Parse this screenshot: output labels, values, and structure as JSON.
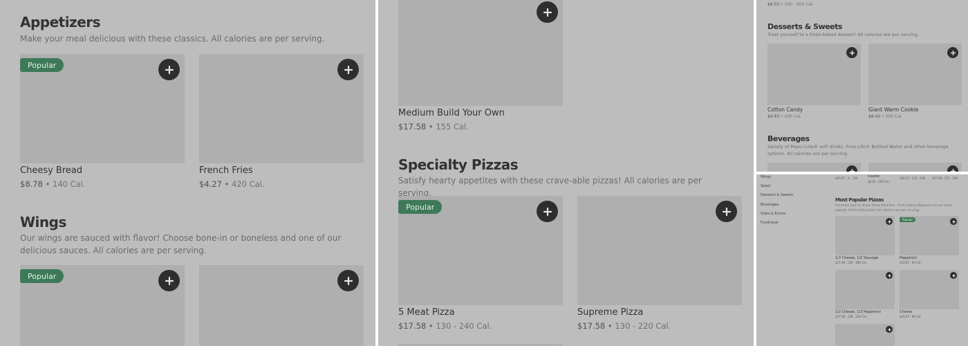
{
  "panel_a": {
    "appetizers": {
      "title": "Appetizers",
      "description": "Make your meal delicious with these classics. All calories are per serving.",
      "items": [
        {
          "badge": "Popular",
          "name": "Cheesy Bread",
          "price": "$8.78",
          "calories": "140 Cal."
        },
        {
          "name": "French Fries",
          "price": "$4.27",
          "calories": "420 Cal."
        }
      ]
    },
    "wings": {
      "title": "Wings",
      "description": "Our wings are sauced with flavor! Choose bone-in or boneless and one of our delicious sauces. All calories are per serving.",
      "items": [
        {
          "badge": "Popular"
        },
        {}
      ]
    }
  },
  "panel_b": {
    "build_your_own": {
      "name": "Medium Build Your Own",
      "price": "$17.58",
      "calories": "155 Cal."
    },
    "specialty_pizzas": {
      "title": "Specialty Pizzas",
      "description": "Satisfy hearty appetites with these crave-able pizzas! All calories are per serving.",
      "items": [
        {
          "badge": "Popular",
          "name": "5 Meat Pizza",
          "price": "$17.58",
          "calories": "130 - 240 Cal."
        },
        {
          "name": "Supreme Pizza",
          "price": "$17.58",
          "calories": "130 - 220 Cal."
        }
      ]
    }
  },
  "panel_c": {
    "top_meta": {
      "price": "$6.03",
      "calories": "100 - 600 Cal."
    },
    "desserts": {
      "title": "Desserts & Sweets",
      "description": "Treat yourself to a fresh-baked dessert! All calories are per serving.",
      "items": [
        {
          "name": "Cotton Candy",
          "price": "$4.93",
          "calories": "200 Cal."
        },
        {
          "name": "Giant Warm Cookie",
          "price": "$8.45",
          "calories": "200 Cal."
        }
      ]
    },
    "beverages": {
      "title": "Beverages",
      "description": "Variety of Pepsi-Cola® soft drinks, Pure Life® Bottled Water and other beverage options. All calories are per serving."
    }
  },
  "panel_d": {
    "sidebar": [
      "Wings",
      "Salad",
      "Desserts & Sweets",
      "Beverages",
      "Sides & Extras",
      "Fundraiser"
    ],
    "top_row": [
      {
        "name": "",
        "meta": "$20.97 · 2... 2/8"
      },
      {
        "name": "Cookie",
        "meta": "$8.45 · 200 Cal."
      },
      {
        "name": "",
        "meta": "$26.12 · 125 - 236"
      },
      {
        "name": "",
        "meta": "$27.58 · 125 - 236"
      }
    ],
    "most_popular": {
      "title": "Most Popular Pizzas",
      "description": "Favorites love to share these favorites - from classic Pepperoni to our most popular half & half pizzas! All calories are per serving.",
      "items": [
        {
          "name": "1/2 Cheese, 1/2 Sausage",
          "meta": "$27.58 · 130 - 280 Cal."
        },
        {
          "badge": "Popular",
          "name": "Pepperoni",
          "meta": "$20.97 · 90 Cal."
        },
        {
          "name": "1/2 Cheese, 1/2 Pepperoni",
          "meta": "$27.58 · 130 - 240 Cal."
        },
        {
          "name": "Cheese",
          "meta": "$20.97 · 80 Cal."
        }
      ]
    }
  },
  "icons": {
    "add": "plus-icon"
  },
  "colors": {
    "badge_green": "#3e7a59",
    "add_button": "#2e2e2e",
    "panel_bg": "#bdbdbd",
    "image_placeholder": "#afafaf"
  }
}
